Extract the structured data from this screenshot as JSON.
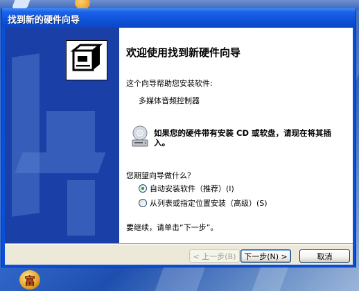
{
  "window": {
    "title": "找到新的硬件向导"
  },
  "wizard": {
    "heading": "欢迎使用找到新硬件向导",
    "intro": "这个向导帮助您安装软件:",
    "device_name": "多媒体音频控制器",
    "cd_prompt": "如果您的硬件带有安装 CD 或软盘，请现在将其插入。",
    "question": "您期望向导做什么？",
    "options": [
      {
        "label": "自动安装软件（推荐）(I)",
        "selected": true
      },
      {
        "label": "从列表或指定位置安装（高级）(S)",
        "selected": false
      }
    ],
    "continue_text": "要继续，请单击“下一步”。"
  },
  "buttons": {
    "back": "< 上一步(B)",
    "next": "下一步(N) >",
    "cancel": "取消"
  },
  "desktop": {
    "bottom_icon_glyph": "富"
  },
  "colors": {
    "titlebar": "#0b47c5",
    "sidebar": "#1a3fa6",
    "radio_dot": "#21a121"
  }
}
